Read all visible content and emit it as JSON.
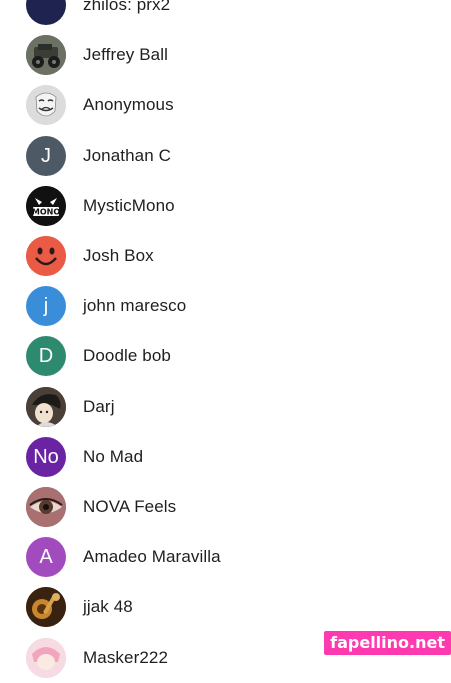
{
  "contacts": [
    {
      "name": "zhilos: prx2",
      "avatar": "photo-icon",
      "color": "#1e2350"
    },
    {
      "name": "Jeffrey Ball",
      "avatar": "monster-truck-photo",
      "color": "#4a5044"
    },
    {
      "name": "Anonymous",
      "avatar": "guy-fawkes-mask-photo",
      "color": "#d9d9d9"
    },
    {
      "name": "Jonathan C",
      "letter": "J",
      "color": "#4d5a66"
    },
    {
      "name": "MysticMono",
      "avatar": "mono-logo-photo",
      "color": "#111111"
    },
    {
      "name": "Josh Box",
      "avatar": "smiley-face-photo",
      "color": "#e8533e"
    },
    {
      "name": "john maresco",
      "letter": "j",
      "color": "#3a8ed9"
    },
    {
      "name": "Doodle bob",
      "letter": "D",
      "color": "#2e8a6e"
    },
    {
      "name": "Darj",
      "avatar": "anime-character-photo",
      "color": "#3b3b3b"
    },
    {
      "name": "No Mad",
      "letter": "No",
      "color": "#6a24a3"
    },
    {
      "name": "NOVA Feels",
      "avatar": "eye-closeup-photo",
      "color": "#8a5a5a"
    },
    {
      "name": "Amadeo Maravilla",
      "letter": "A",
      "color": "#a24bbf"
    },
    {
      "name": "jjak 48",
      "avatar": "instrument-photo",
      "color": "#7a4a1c"
    },
    {
      "name": "Masker222",
      "avatar": "pink-anime-photo",
      "color": "#f2c9d4"
    }
  ],
  "watermark": "fapellino.net"
}
